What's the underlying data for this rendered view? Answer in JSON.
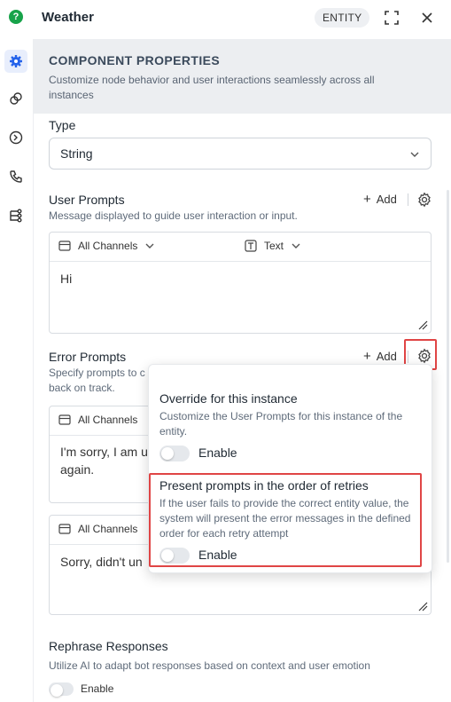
{
  "header": {
    "title": "Weather",
    "badge": "ENTITY",
    "logo_glyph": "?",
    "expand_icon": "expand-icon",
    "close_icon": "close-icon"
  },
  "rail": {
    "items": [
      {
        "icon": "gear-icon",
        "active": true
      },
      {
        "icon": "link-icon",
        "active": false
      },
      {
        "icon": "history-icon",
        "active": false
      },
      {
        "icon": "phone-icon",
        "active": false
      },
      {
        "icon": "flow-icon",
        "active": false
      }
    ]
  },
  "banner": {
    "title": "COMPONENT PROPERTIES",
    "description": "Customize node behavior and user interactions seamlessly across all instances"
  },
  "type_field": {
    "label": "Type",
    "value": "String"
  },
  "user_prompts": {
    "title": "User Prompts",
    "description": "Message displayed to guide user interaction or input.",
    "add_label": "Add",
    "channel_label": "All Channels",
    "format_label": "Text",
    "text": "Hi"
  },
  "error_prompts": {
    "title": "Error Prompts",
    "description_line1": "Specify prompts to c",
    "description_line2": "back on track.",
    "add_label": "Add",
    "items": [
      {
        "channel_label": "All Channels",
        "text_line1": "I'm sorry, I am ur",
        "text_line2": "again."
      },
      {
        "channel_label": "All Channels",
        "text_line1": "Sorry, didn't un",
        "text_line2": ""
      }
    ]
  },
  "rephrase": {
    "title": "Rephrase Responses",
    "description": "Utilize AI to adapt bot responses based on context and user emotion",
    "enable_label": "Enable",
    "enabled": false
  },
  "popover": {
    "override": {
      "title": "Override for this instance",
      "description": "Customize the User Prompts for this instance of the entity.",
      "enable_label": "Enable",
      "enabled": false
    },
    "order": {
      "title": "Present prompts in the order of retries",
      "description": "If the user fails to provide the correct entity value, the system will present the error messages in the defined order for each retry attempt",
      "enable_label": "Enable",
      "enabled": false
    }
  },
  "colors": {
    "accent": "#2563eb",
    "highlight": "#e04545",
    "banner_bg": "#eceef1",
    "logo": "#17a34a"
  }
}
